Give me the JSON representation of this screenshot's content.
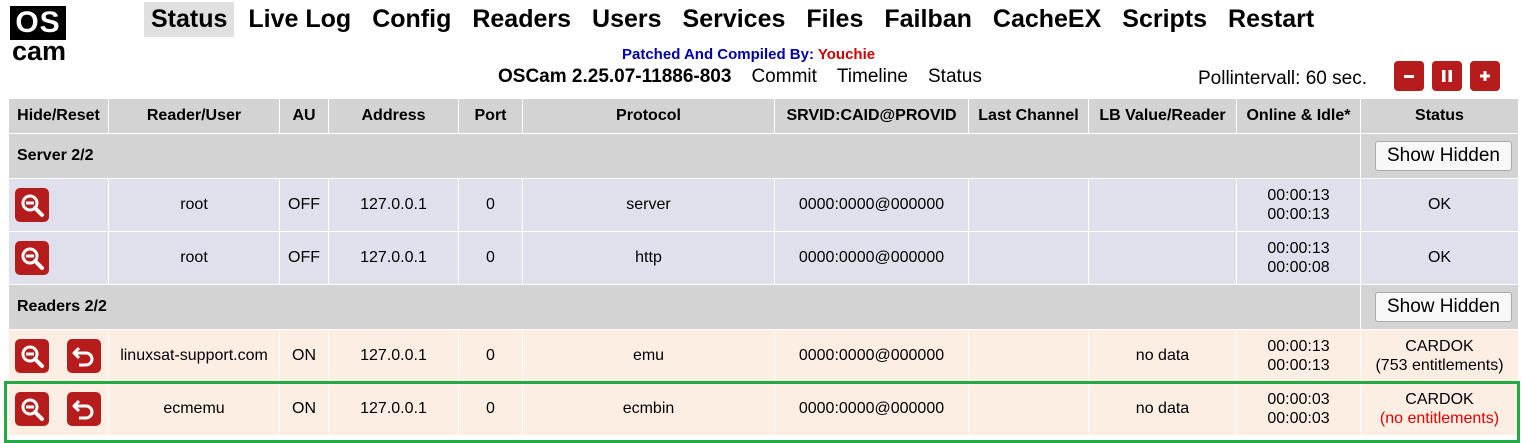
{
  "logo": {
    "top": "OS",
    "bottom": "cam"
  },
  "nav": [
    "Status",
    "Live Log",
    "Config",
    "Readers",
    "Users",
    "Services",
    "Files",
    "Failban",
    "CacheEX",
    "Scripts",
    "Restart"
  ],
  "compiled": {
    "label": "Patched And Compiled By:",
    "name": "Youchie"
  },
  "version": {
    "text": "OSCam 2.25.07-11886-803",
    "links": [
      "Commit",
      "Timeline",
      "Status"
    ]
  },
  "poll": {
    "label": "Pollintervall: 60 sec."
  },
  "pollButtons": {
    "minus": "minus-icon",
    "pause": "pause-icon",
    "plus": "plus-icon"
  },
  "table": {
    "headers": [
      "Hide/Reset",
      "Reader/User",
      "AU",
      "Address",
      "Port",
      "Protocol",
      "SRVID:CAID@PROVID",
      "Last Channel",
      "LB Value/Reader",
      "Online & Idle*",
      "Status"
    ]
  },
  "groups": {
    "server": {
      "title": "Server 2/2",
      "showHidden": "Show Hidden",
      "rows": [
        {
          "user": "root",
          "au": "OFF",
          "address": "127.0.0.1",
          "port": "0",
          "protocol": "server",
          "srvid": "0000:0000@000000",
          "lastchannel": "",
          "lb": "",
          "online": "00:00:13",
          "idle": "00:00:13",
          "status": "OK"
        },
        {
          "user": "root",
          "au": "OFF",
          "address": "127.0.0.1",
          "port": "0",
          "protocol": "http",
          "srvid": "0000:0000@000000",
          "lastchannel": "",
          "lb": "",
          "online": "00:00:13",
          "idle": "00:00:08",
          "status": "OK"
        }
      ]
    },
    "readers": {
      "title": "Readers 2/2",
      "showHidden": "Show Hidden",
      "rows": [
        {
          "user": "linuxsat-support.com",
          "au": "ON",
          "address": "127.0.0.1",
          "port": "0",
          "protocol": "emu",
          "srvid": "0000:0000@000000",
          "lastchannel": "",
          "lb": "no data",
          "online": "00:00:13",
          "idle": "00:00:13",
          "status": "CARDOK",
          "entitlements": "(753 entitlements)"
        },
        {
          "user": "ecmemu",
          "au": "ON",
          "address": "127.0.0.1",
          "port": "0",
          "protocol": "ecmbin",
          "srvid": "0000:0000@000000",
          "lastchannel": "",
          "lb": "no data",
          "online": "00:00:03",
          "idle": "00:00:03",
          "status": "CARDOK",
          "entitlements": "(no entitlements)"
        }
      ]
    }
  },
  "colors": {
    "accent": "#b71c1c",
    "header": "#d3d3d3",
    "serverRow": "#e0e0ec",
    "readerRow": "#fdeee3",
    "highlight": "#22aa44",
    "compiledBy": "#0000aa",
    "name": "#d00000",
    "noEntitlements": "#e00000"
  }
}
